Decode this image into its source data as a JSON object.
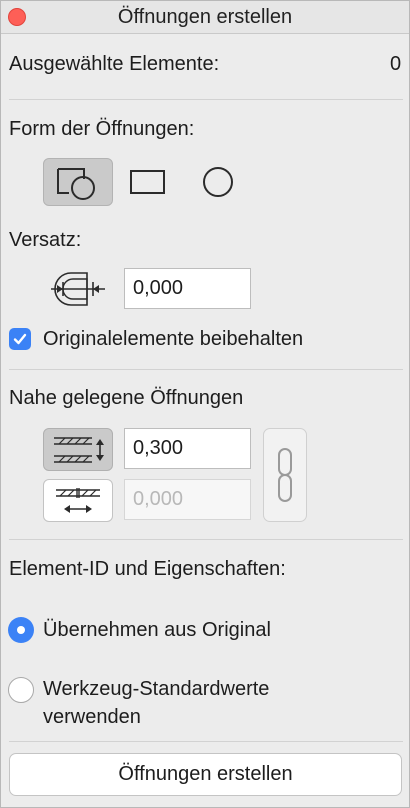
{
  "window": {
    "title": "Öffnungen erstellen"
  },
  "selected": {
    "label": "Ausgewählte Elemente:",
    "count": "0"
  },
  "form": {
    "label": "Form der Öffnungen:",
    "options": [
      "shape-from-element",
      "rectangle",
      "circle"
    ],
    "selected": "shape-from-element"
  },
  "offset": {
    "label": "Versatz:",
    "value": "0,000"
  },
  "keep_original": {
    "label": "Originalelemente beibehalten",
    "checked": true
  },
  "nearby": {
    "label": "Nahe gelegene Öffnungen",
    "value1": "0,300",
    "value2": "0,000",
    "linked": true
  },
  "element_id": {
    "label": "Element-ID und Eigenschaften:",
    "options": [
      {
        "label": "Übernehmen aus Original",
        "selected": true
      },
      {
        "label_line1": "Werkzeug-Standardwerte",
        "label_line2": "verwenden",
        "selected": false
      }
    ]
  },
  "create_button": {
    "label": "Öffnungen erstellen"
  },
  "colors": {
    "accent": "#3b82f6",
    "close": "#fe5f57",
    "panel": "#ececec"
  }
}
